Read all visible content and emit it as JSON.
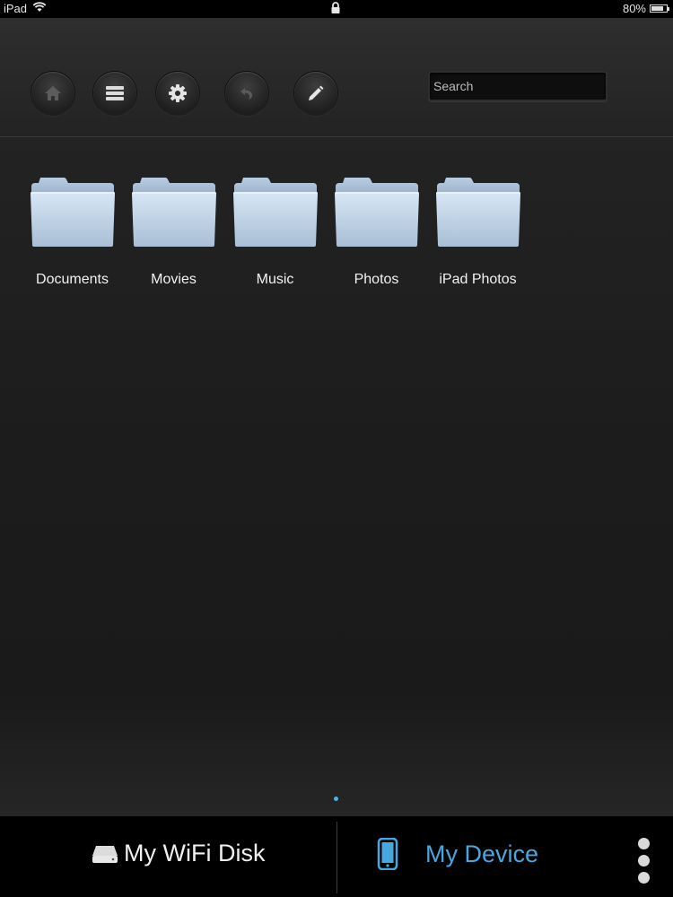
{
  "status_bar": {
    "device": "iPad",
    "battery": "80%",
    "battery_level": 0.8
  },
  "toolbar": {
    "buttons": [
      {
        "icon": "home-icon"
      },
      {
        "icon": "list-icon"
      },
      {
        "icon": "gear-icon"
      },
      {
        "icon": "undo-icon"
      },
      {
        "icon": "pencil-icon"
      }
    ],
    "search": {
      "placeholder": "Search",
      "value": ""
    }
  },
  "folders": [
    {
      "label": "Documents"
    },
    {
      "label": "Movies"
    },
    {
      "label": "Music"
    },
    {
      "label": "Photos"
    },
    {
      "label": "iPad Photos"
    }
  ],
  "pager": {
    "pages": 1,
    "current": 1,
    "accent": "#4fb3e6"
  },
  "tabbar": {
    "wifi_disk_label": "My WiFi Disk",
    "device_label": "My Device",
    "active_tab": "My Device",
    "active_color": "#46a8df"
  }
}
